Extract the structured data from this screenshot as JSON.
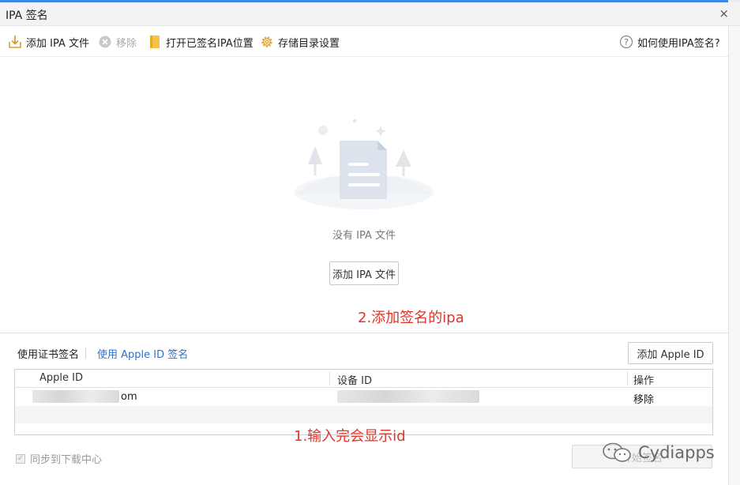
{
  "window": {
    "title": "IPA 签名",
    "close_glyph": "×"
  },
  "toolbar": {
    "add_ipa": {
      "label": "添加 IPA 文件",
      "icon": "import-icon"
    },
    "remove": {
      "label": "移除",
      "icon": "remove-circle-icon",
      "disabled": true
    },
    "open_folder": {
      "label": "打开已签名IPA位置",
      "icon": "folder-icon"
    },
    "storage_settings": {
      "label": "存储目录设置",
      "icon": "gear-icon"
    },
    "help": {
      "label": "如何使用IPA签名?",
      "icon": "question-icon"
    }
  },
  "empty_state": {
    "message": "没有 IPA 文件",
    "button_label": "添加 IPA 文件"
  },
  "annotations": {
    "step2": "2.添加签名的ipa",
    "step1": "1.输入完会显示id"
  },
  "sign_tabs": {
    "cert": "使用证书签名",
    "apple_id": "使用 Apple ID 签名"
  },
  "add_apple_id_label": "添加 Apple ID",
  "table": {
    "columns": [
      "Apple ID",
      "设备 ID",
      "操作"
    ],
    "rows": [
      {
        "apple_id_visible": "om",
        "action": "移除"
      }
    ]
  },
  "sync": {
    "label": "同步到下载中心",
    "checked": true
  },
  "start_button": {
    "label": "开始签名"
  },
  "watermark": {
    "text": "Cydiapps"
  },
  "colors": {
    "accent_blue": "#2f72c9",
    "annotation_red": "#e03428",
    "folder_yellow": "#f5c242",
    "gear_orange": "#e8a33a"
  }
}
